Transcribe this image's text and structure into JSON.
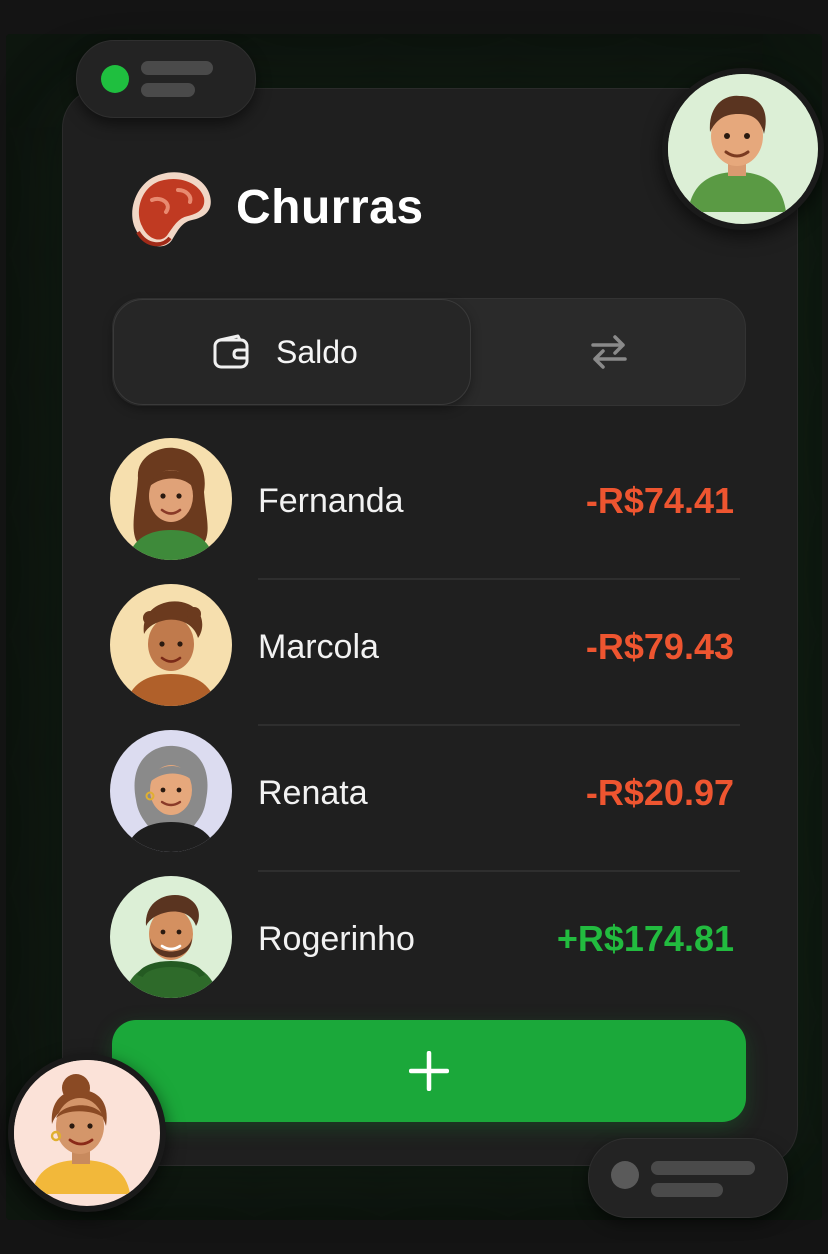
{
  "app": {
    "title": "Churras",
    "icon": "steak-icon"
  },
  "segmented": {
    "active_label": "Saldo",
    "active_icon": "wallet-icon",
    "inactive_icon": "swap-arrows-icon"
  },
  "balances": [
    {
      "name": "Fernanda",
      "amount": "-R$74.41",
      "sign": "negative"
    },
    {
      "name": "Marcola",
      "amount": "-R$79.43",
      "sign": "negative"
    },
    {
      "name": "Renata",
      "amount": "-R$20.97",
      "sign": "negative"
    },
    {
      "name": "Rogerinho",
      "amount": "+R$174.81",
      "sign": "positive"
    }
  ],
  "actions": {
    "add_icon": "plus-icon"
  },
  "colors": {
    "accent": "#1ba83a",
    "negative": "#ee5530",
    "positive": "#22bb3f",
    "background": "#1f1f1f"
  }
}
